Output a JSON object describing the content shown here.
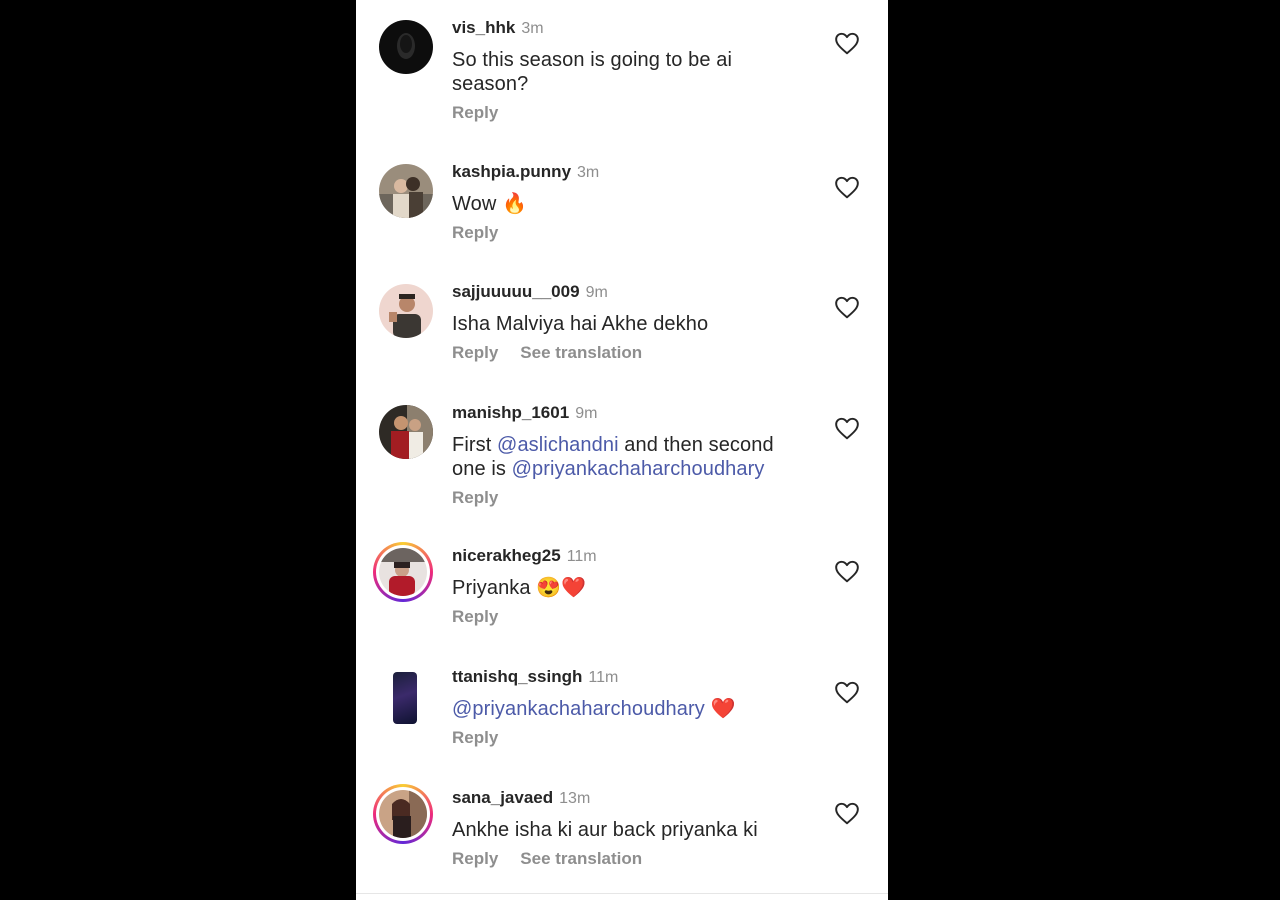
{
  "comments": [
    {
      "username": "vis_hhk",
      "time": "3m",
      "text_parts": [
        "So this season is going to be ai season?"
      ],
      "reply": "Reply"
    },
    {
      "username": "kashpia.punny",
      "time": "3m",
      "text_parts": [
        "Wow 🔥"
      ],
      "reply": "Reply"
    },
    {
      "username": "sajjuuuuu__009",
      "time": "9m",
      "text_parts": [
        "Isha Malviya hai Akhe dekho"
      ],
      "reply": "Reply",
      "translation": "See translation"
    },
    {
      "username": "manishp_1601",
      "time": "9m",
      "text_before": "First ",
      "mention1": "@aslichandni",
      "text_middle": " and then second one is ",
      "mention2": "@priyankachaharchoudhary",
      "reply": "Reply"
    },
    {
      "username": "nicerakheg25",
      "time": "11m",
      "text_parts": [
        "Priyanka 😍❤️"
      ],
      "reply": "Reply"
    },
    {
      "username": "ttanishq_ssingh",
      "time": "11m",
      "mention": "@priyankachaharchoudhary",
      "text_after": " ❤️",
      "reply": "Reply"
    },
    {
      "username": "sana_javaed",
      "time": "13m",
      "text_parts": [
        "Ankhe isha ki aur back priyanka ki"
      ],
      "reply": "Reply",
      "translation": "See translation"
    }
  ],
  "colors": {
    "background": "#000000",
    "panel": "#ffffff",
    "text": "#262626",
    "muted": "#8e8e8e",
    "mention": "#4c5aa8"
  }
}
